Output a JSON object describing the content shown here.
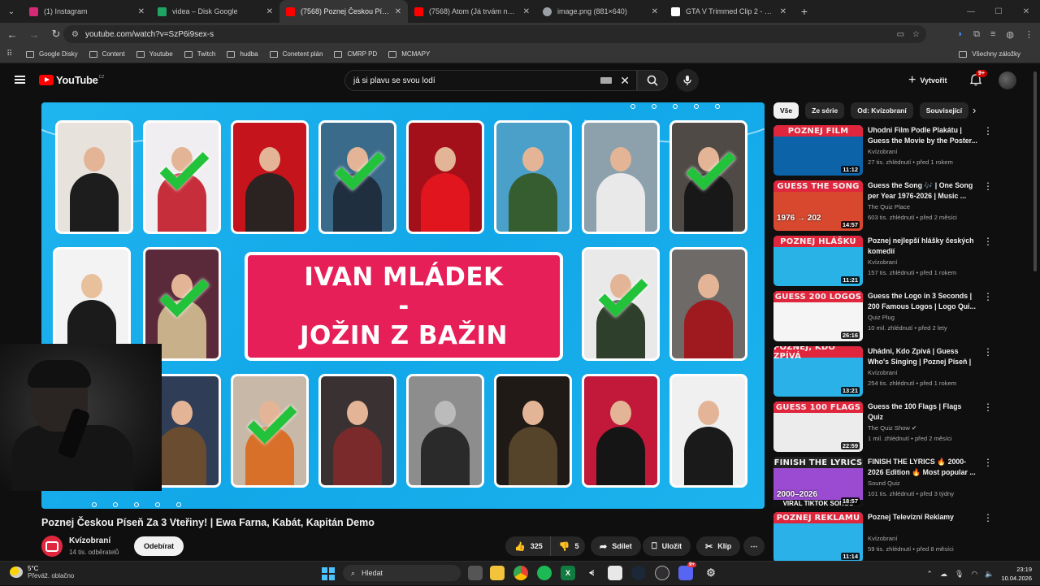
{
  "browser": {
    "tabs": [
      {
        "title": "(1) Instagram",
        "favicon_color": "#d62976"
      },
      {
        "title": "videa – Disk Google",
        "favicon_color": "#1fa463"
      },
      {
        "title": "(7568) Poznej Českou Píseň Za 3",
        "favicon_color": "#ff0000",
        "active": true
      },
      {
        "title": "(7568) Atom (Já trvám na tom h",
        "favicon_color": "#ff0000"
      },
      {
        "title": "image.png (881×640)",
        "favicon_color": "#9aa0a6"
      },
      {
        "title": "GTA V Trimmed Clip 2 - Clipper",
        "favicon_color": "#ffffff"
      }
    ],
    "url": "youtube.com/watch?v=SzP6i9sex-s",
    "bookmarks": [
      "Google Disky",
      "Content",
      "Youtube",
      "Twitch",
      "hudba",
      "Conetent plán",
      "CMRP PD",
      "MCMAPY"
    ],
    "all_bookmarks": "Všechny záložky"
  },
  "youtube": {
    "logo_text": "YouTube",
    "logo_country": "CZ",
    "search_query": "já si plavu se svou lodí",
    "create_label": "Vytvořit",
    "notif_count": "9+",
    "thumbnail_title_line1": "IVAN MLÁDEK",
    "thumbnail_title_line2": "-",
    "thumbnail_title_line3": "JOŽIN Z BAŽIN",
    "video_title": "Poznej Českou Píseň Za 3 Vteřiny! | Ewa Farna, Kabát, Kapitán Demo",
    "channel_name": "Kvízobraní",
    "channel_subs": "14 tis. odběratelů",
    "subscribe_label": "Odebírat",
    "likes": "325",
    "dislikes": "5",
    "share_label": "Sdílet",
    "save_label": "Uložit",
    "clip_label": "Klip",
    "chips": [
      "Vše",
      "Ze série",
      "Od: Kvízobraní",
      "Související"
    ],
    "recommendations": [
      {
        "band": "POZNEJ FILM",
        "band_accent": "FILM",
        "band_bg": "#e0263d",
        "thumb_bg": "#0d63a8",
        "duration": "11:12",
        "title": "Uhodni Film Podle Plakátu | Guess the Movie by the Poster...",
        "channel": "Kvízobraní",
        "meta": "27 tis. zhlédnutí • před 1 rokem",
        "verified": false
      },
      {
        "band": "GUESS THE SONG",
        "band_accent": "SONG",
        "band_bg": "#e0263d",
        "thumb_bg": "#d8482f",
        "duration": "14:57",
        "title": "Guess the Song 🎶 | One Song per Year 1976-2026 | Music ...",
        "channel": "The Quiz Place",
        "meta": "603 tis. zhlédnutí • před 2 měsíci",
        "verified": false,
        "overlay": "1976 → 202"
      },
      {
        "band": "POZNEJ HLÁŠKU",
        "band_accent": "HLÁŠKU",
        "band_bg": "#e0263d",
        "thumb_bg": "#28b2e6",
        "duration": "11:21",
        "title": "Poznej nejlepší hlášky českých komedií",
        "channel": "Kvízobraní",
        "meta": "157 tis. zhlédnutí • před 1 rokem",
        "verified": false
      },
      {
        "band": "GUESS 200 LOGOS",
        "band_accent": "200 LOGOS",
        "band_bg": "#e0263d",
        "thumb_bg": "#f5f5f5",
        "duration": "26:16",
        "title": "Guess the Logo in 3 Seconds | 200 Famous Logos | Logo Qui...",
        "channel": "Quiz Plug",
        "meta": "10 mil. zhlédnutí • před 2 lety",
        "verified": false
      },
      {
        "band": "POZNEJ, KDO ZPÍVÁ",
        "band_accent": "KDO ZPÍVÁ",
        "band_bg": "#e0263d",
        "thumb_bg": "#2ab1e8",
        "duration": "13:21",
        "title": "Uhádni, Kdo Zpívá | Guess Who's Singing | Poznej Píseň | ...",
        "channel": "Kvízobraní",
        "meta": "254 tis. zhlédnutí • před 1 rokem",
        "verified": false
      },
      {
        "band": "GUESS 100 FLAGS",
        "band_accent": "100 FLAGS",
        "band_bg": "#e0263d",
        "thumb_bg": "#ececec",
        "duration": "22:59",
        "title": "Guess the 100 Flags | Flags Quiz",
        "channel": "The Quiz Show",
        "meta": "1 mil. zhlédnutí • před 2 měsíci",
        "verified": true
      },
      {
        "band": "FINISH THE LYRICS",
        "band_accent": "LYRICS",
        "band_bg": "#222222",
        "thumb_bg": "#9b4bd1",
        "duration": "18:57",
        "title": "FINISH THE LYRICS 🔥 2000-2026 Edition 🔥 Most popular ...",
        "channel": "Sound Quiz",
        "meta": "101 tis. zhlédnutí • před 3 týdny",
        "verified": false,
        "overlay": "2000–2026",
        "overlay2": "VIRAL TIKTOK SONGS"
      },
      {
        "band": "POZNEJ REKLAMU",
        "band_accent": "REKLAMU",
        "band_bg": "#e0263d",
        "thumb_bg": "#2ab1e8",
        "duration": "11:14",
        "title": "Poznej Televizní Reklamy",
        "channel": "Kvízobraní",
        "meta": "59 tis. zhlédnutí • před 8 měsíci",
        "verified": false
      }
    ]
  },
  "taskbar": {
    "temp": "5°C",
    "weather": "Převáž. oblačno",
    "search_label": "Hledat",
    "badge": "9+",
    "time": "23:19",
    "date": "10.04.2026"
  },
  "colors": {
    "yt_red": "#ff0000",
    "thumbnail_blue": "#1fb5ef",
    "title_pink": "#e61f58",
    "check_green": "#22c33a"
  }
}
